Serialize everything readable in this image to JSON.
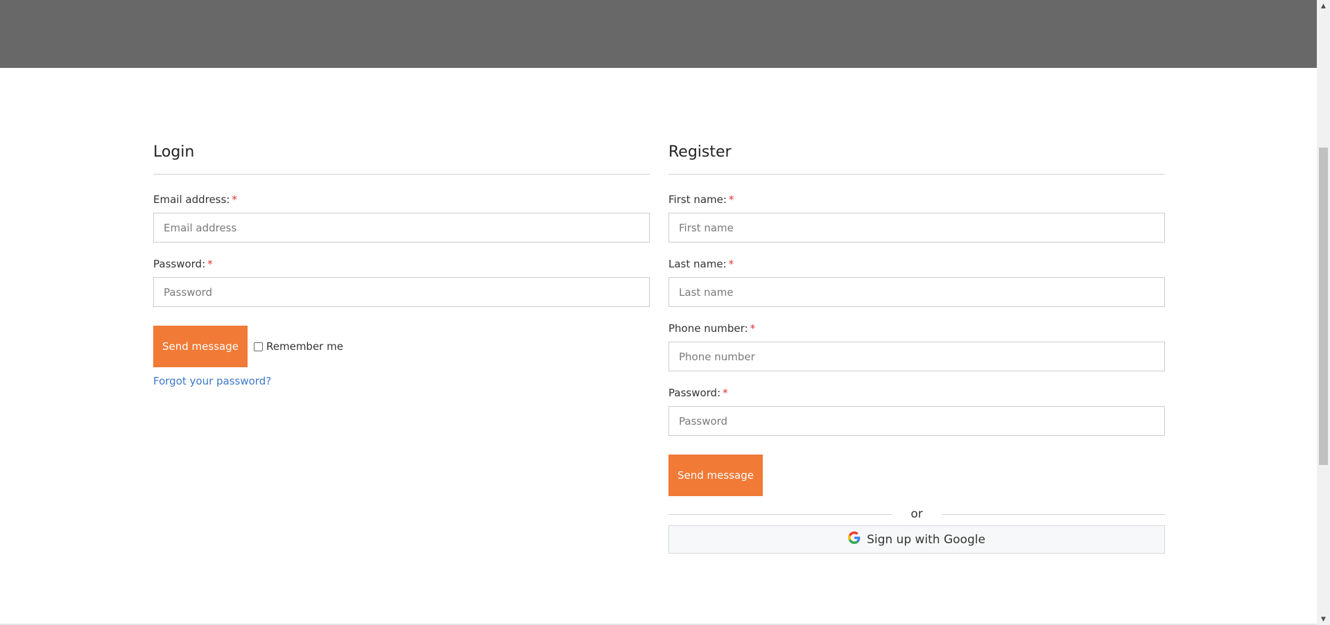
{
  "login": {
    "title": "Login",
    "email": {
      "label": "Email address:",
      "required": "*",
      "placeholder": "Email address",
      "value": ""
    },
    "password": {
      "label": "Password:",
      "required": "*",
      "placeholder": "Password",
      "value": ""
    },
    "submit_label": "Send message",
    "remember_label": "Remember me",
    "remember_checked": false,
    "forgot_label": "Forgot your password?"
  },
  "register": {
    "title": "Register",
    "first_name": {
      "label": "First name:",
      "required": "*",
      "placeholder": "First name",
      "value": ""
    },
    "last_name": {
      "label": "Last name:",
      "required": "*",
      "placeholder": "Last name",
      "value": ""
    },
    "phone": {
      "label": "Phone number:",
      "required": "*",
      "placeholder": "Phone number",
      "value": ""
    },
    "password": {
      "label": "Password:",
      "required": "*",
      "placeholder": "Password",
      "value": ""
    },
    "submit_label": "Send message",
    "separator": "or",
    "google_label": "Sign up with Google",
    "google_icon": "google-g-icon"
  },
  "colors": {
    "header_bg": "#686868",
    "accent": "#f07a36",
    "link": "#3d78c9",
    "required": "#e03131"
  }
}
